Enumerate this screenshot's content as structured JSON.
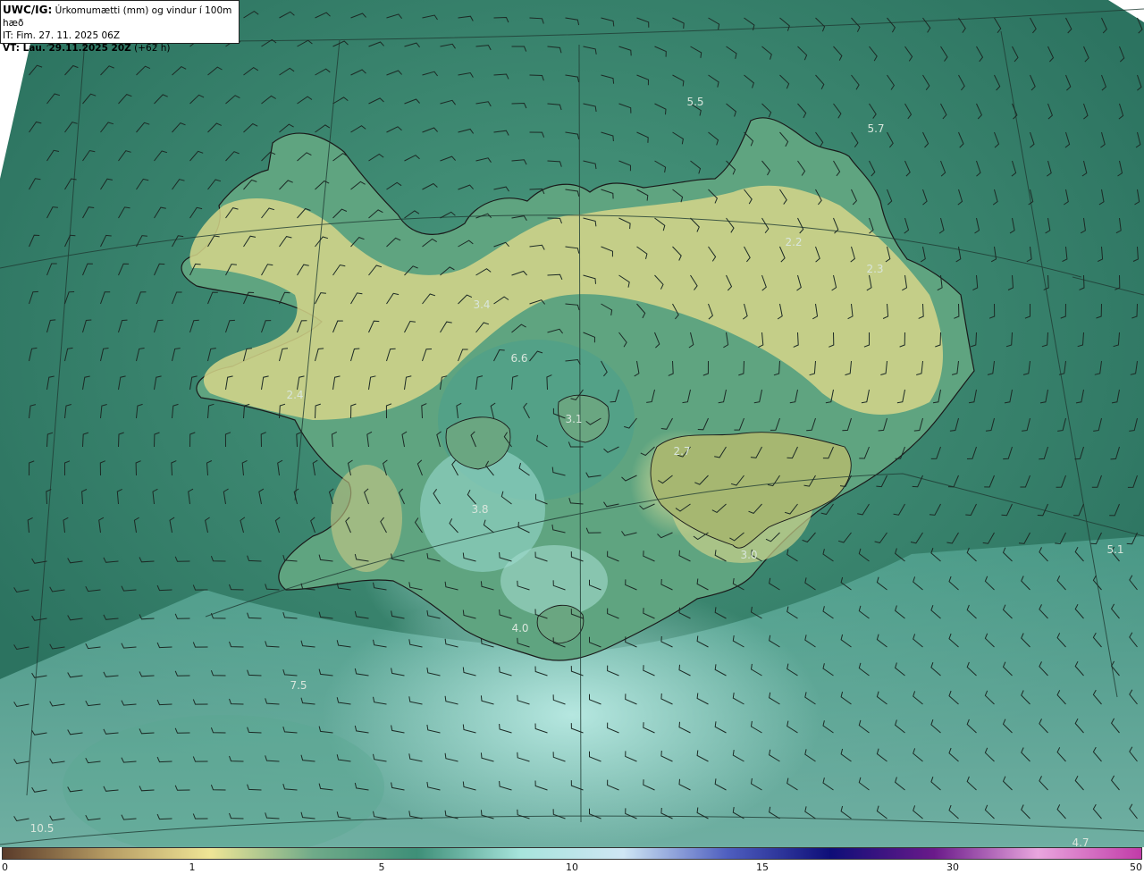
{
  "info": {
    "model_label": "UWC/IG:",
    "product": "Úrkomumætti (mm) og vindur í 100m hæð",
    "it": "IT: Fim. 27. 11. 2025 06Z",
    "vt_label": "VT: Lau. 29.11.2025 20Z",
    "vt_offset": "(+62 h)"
  },
  "value_labels": [
    "5.5",
    "5.7",
    "2.2",
    "2.3",
    "2.4",
    "3.4",
    "6.6",
    "3.1",
    "2.7",
    "3.8",
    "3.0",
    "5.1",
    "4.0",
    "7.5",
    "10.5",
    "4.7"
  ],
  "colorbar": {
    "ticks": [
      "0",
      "1",
      "5",
      "10",
      "15",
      "30",
      "50"
    ],
    "colors": [
      "#5a3b2a",
      "#b59b63",
      "#efe596",
      "#6faa89",
      "#3e8f78",
      "#a7e4dc",
      "#cfe6f4",
      "#4f5fc0",
      "#0e0e78",
      "#6a1a8a",
      "#e9a6de",
      "#c13ba8"
    ]
  },
  "colors": {
    "ocean": "#2f7a66",
    "land_low": "#3f8f76",
    "land_high": "#d9d98d",
    "wet": "#8ad2c8",
    "coast": "#1a1a1a"
  }
}
